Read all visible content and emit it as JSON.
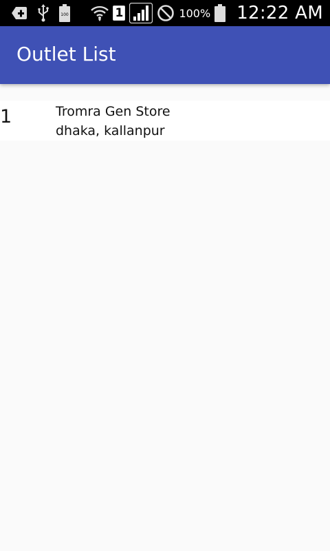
{
  "status_bar": {
    "icons_left": [
      "add-notification-icon",
      "usb-icon",
      "battery-charging-icon"
    ],
    "icons_right": [
      "wifi-icon",
      "sim-indicator-icon",
      "cell-signal-icon",
      "do-not-disturb-icon",
      "battery-icon"
    ],
    "sim_number": "1",
    "battery_percent": "100%",
    "time": "12:22 AM"
  },
  "app_bar": {
    "title": "Outlet List",
    "color": "#3f51b5"
  },
  "outlets": [
    {
      "index": "1",
      "name": "Tromra Gen Store",
      "address": "dhaka, kallanpur"
    }
  ]
}
